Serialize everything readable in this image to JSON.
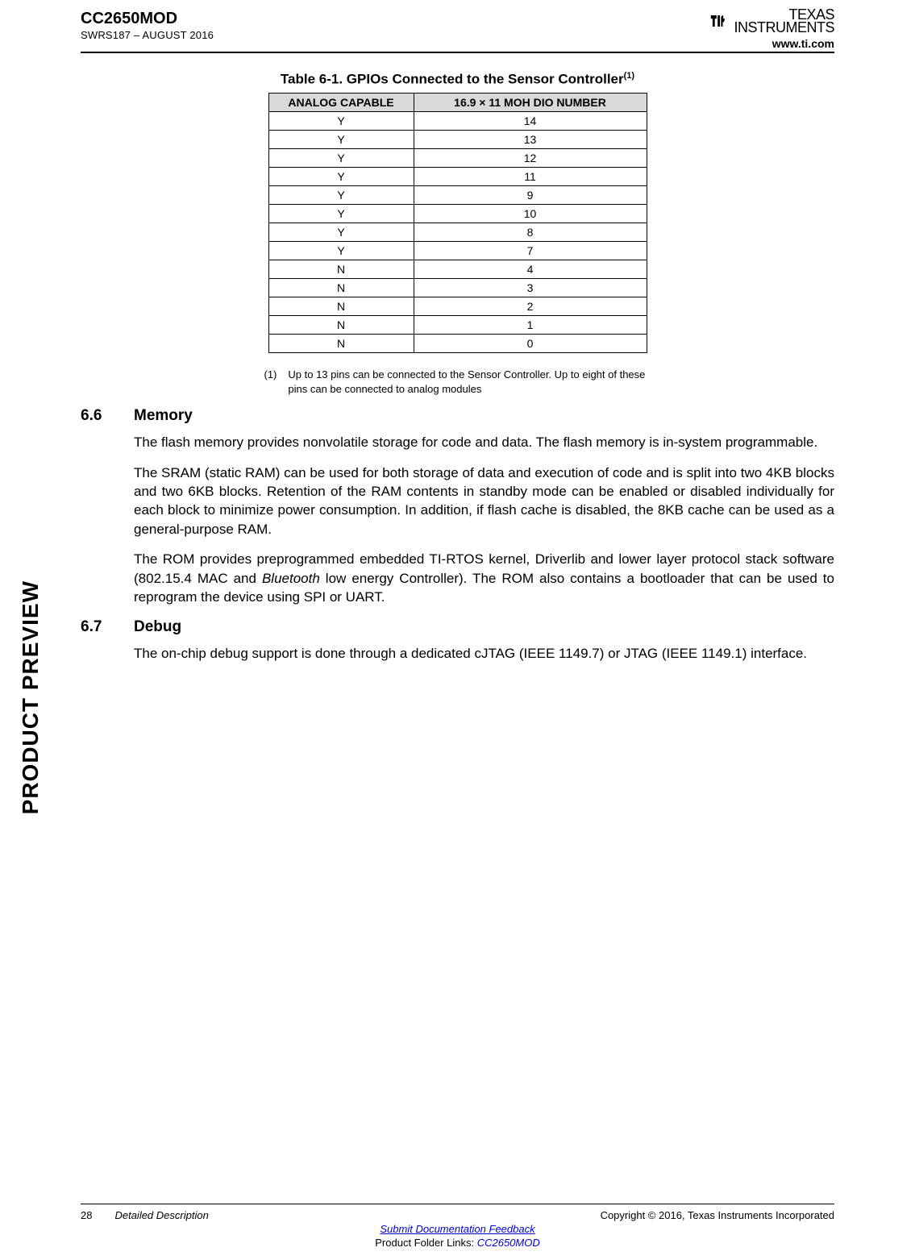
{
  "header": {
    "product": "CC2650MOD",
    "doc_id": "SWRS187 – AUGUST 2016",
    "company_line1": "TEXAS",
    "company_line2": "INSTRUMENTS",
    "url": "www.ti.com"
  },
  "table": {
    "caption_prefix": "Table 6-1. GPIOs Connected to the Sensor Controller",
    "caption_sup": "(1)",
    "headers": [
      "ANALOG CAPABLE",
      "16.9 × 11 MOH DIO NUMBER"
    ],
    "rows": [
      [
        "Y",
        "14"
      ],
      [
        "Y",
        "13"
      ],
      [
        "Y",
        "12"
      ],
      [
        "Y",
        "11"
      ],
      [
        "Y",
        "9"
      ],
      [
        "Y",
        "10"
      ],
      [
        "Y",
        "8"
      ],
      [
        "Y",
        "7"
      ],
      [
        "N",
        "4"
      ],
      [
        "N",
        "3"
      ],
      [
        "N",
        "2"
      ],
      [
        "N",
        "1"
      ],
      [
        "N",
        "0"
      ]
    ],
    "footnote_num": "(1)",
    "footnote_text": "Up to 13 pins can be connected to the Sensor Controller. Up to eight of these pins can be connected to analog modules"
  },
  "sections": {
    "memory": {
      "num": "6.6",
      "title": "Memory",
      "p1": "The flash memory provides nonvolatile storage for code and data. The flash memory is in-system programmable.",
      "p2": "The SRAM (static RAM) can be used for both storage of data and execution of code and is split into two 4KB blocks and two 6KB blocks. Retention of the RAM contents in standby mode can be enabled or disabled individually for each block to minimize power consumption. In addition, if flash cache is disabled, the 8KB cache can be used as a general-purpose RAM.",
      "p3_pre": "The ROM provides preprogrammed embedded TI-RTOS kernel, Driverlib and lower layer protocol stack software (802.15.4 MAC and ",
      "p3_it": "Bluetooth",
      "p3_post": " low energy Controller). The ROM also contains a bootloader that can be used to reprogram the device using SPI or UART."
    },
    "debug": {
      "num": "6.7",
      "title": "Debug",
      "p1": "The on-chip debug support is done through a dedicated cJTAG (IEEE 1149.7) or JTAG (IEEE 1149.1) interface."
    }
  },
  "side_label": "PRODUCT PREVIEW",
  "footer": {
    "page_num": "28",
    "section_name": "Detailed Description",
    "copyright": "Copyright © 2016, Texas Instruments Incorporated",
    "feedback_link": "Submit Documentation Feedback",
    "folder_pre": "Product Folder Links: ",
    "folder_link": "CC2650MOD"
  }
}
